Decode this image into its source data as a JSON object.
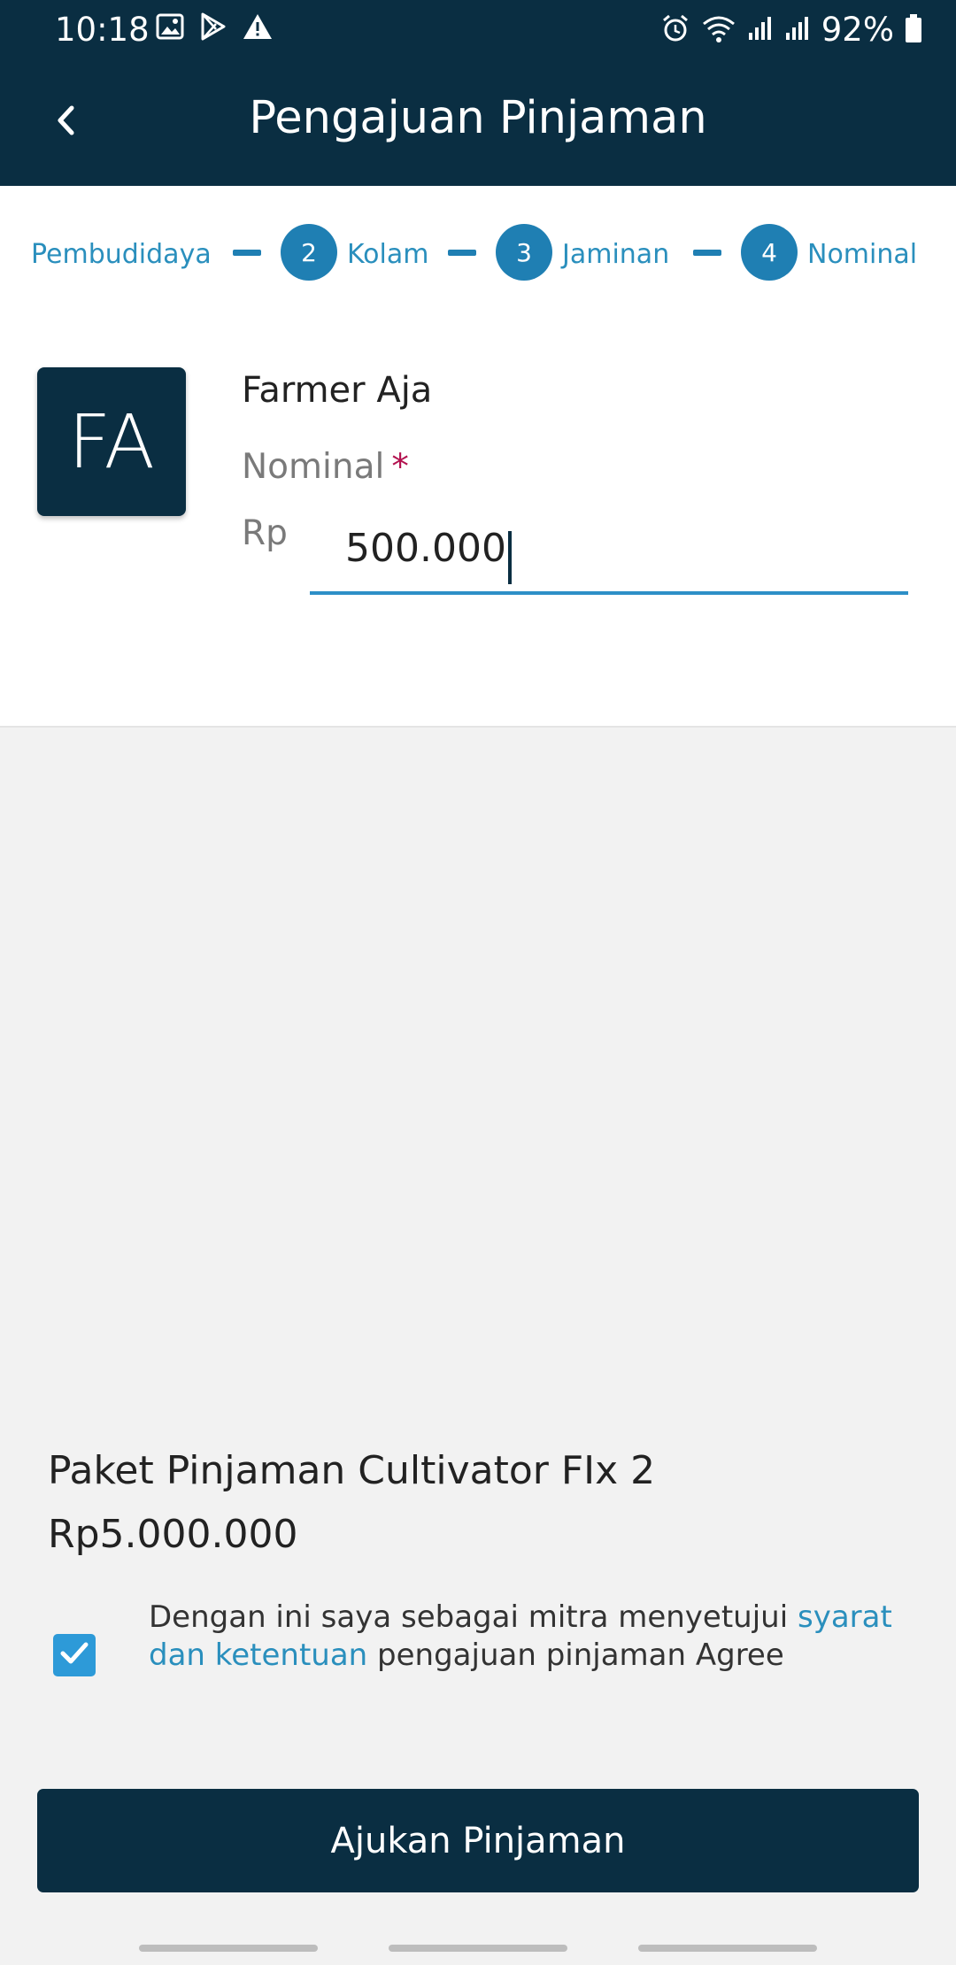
{
  "status_bar": {
    "time": "10:18",
    "battery_percent": "92%",
    "left_icons": [
      "image-icon",
      "play-store-icon",
      "warning-icon"
    ],
    "right_icons": [
      "alarm-icon",
      "wifi-icon",
      "signal-icon",
      "signal-icon",
      "battery-icon"
    ]
  },
  "app_bar": {
    "title": "Pengajuan Pinjaman"
  },
  "stepper": {
    "steps": [
      {
        "number": "",
        "label": "Pembudidaya"
      },
      {
        "number": "2",
        "label": "Kolam"
      },
      {
        "number": "3",
        "label": "Jaminan"
      },
      {
        "number": "4",
        "label": "Nominal"
      }
    ]
  },
  "farmer": {
    "initials": "FA",
    "name": "Farmer Aja"
  },
  "nominal": {
    "label": "Nominal",
    "required_mark": "*",
    "currency_prefix": "Rp",
    "value": "500.000"
  },
  "package": {
    "name": "Paket Pinjaman Cultivator FIx 2",
    "price": "Rp5.000.000"
  },
  "agreement": {
    "checked": true,
    "text_before": "Dengan ini saya sebagai mitra menyetujui ",
    "link_text": "syarat dan ketentuan",
    "text_after": " pengajuan pinjaman Agree"
  },
  "submit": {
    "label": "Ajukan Pinjaman"
  },
  "colors": {
    "primary_dark": "#0a2e42",
    "accent_blue": "#1f7fb3",
    "link_blue": "#2a8fbd",
    "checkbox_blue": "#2d9ad8",
    "required_red": "#b3124f"
  }
}
